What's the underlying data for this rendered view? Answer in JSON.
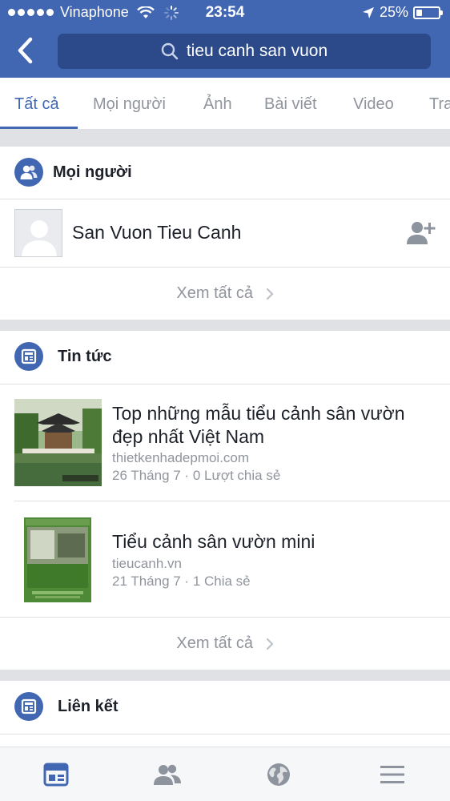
{
  "status_bar": {
    "carrier": "Vinaphone",
    "time": "23:54",
    "battery": "25%",
    "battery_level": 0.25
  },
  "header": {
    "back_icon": "chevron-left-icon",
    "search_icon": "search-icon",
    "query": "tieu canh san vuon"
  },
  "tabs": [
    {
      "label": "Tất cả",
      "active": true
    },
    {
      "label": "Mọi người",
      "active": false
    },
    {
      "label": "Ảnh",
      "active": false
    },
    {
      "label": "Bài viết",
      "active": false
    },
    {
      "label": "Video",
      "active": false
    },
    {
      "label": "Tra",
      "active": false
    }
  ],
  "people_section": {
    "title": "Mọi người",
    "icon": "people-icon",
    "results": [
      {
        "name": "San Vuon Tieu Canh",
        "action_icon": "add-friend-icon"
      }
    ],
    "see_all": "Xem tất cả"
  },
  "news_section": {
    "title": "Tin tức",
    "icon": "news-icon",
    "items": [
      {
        "title": "Top những mẫu tiểu cảnh sân vườn đẹp nhất Việt Nam",
        "domain": "thietkenhadepmoi.com",
        "meta": "26 Tháng 7 · 0 Lượt chia sẻ"
      },
      {
        "title": "Tiểu cảnh sân vườn mini",
        "domain": "tieucanh.vn",
        "meta": "21 Tháng 7 · 1 Chia sẻ"
      }
    ],
    "see_all": "Xem tất cả"
  },
  "links_section": {
    "title": "Liên kết",
    "icon": "news-icon"
  },
  "bottom_nav": [
    {
      "icon": "news-feed-icon",
      "active": true
    },
    {
      "icon": "friends-icon",
      "active": false
    },
    {
      "icon": "globe-icon",
      "active": false
    },
    {
      "icon": "menu-icon",
      "active": false
    }
  ],
  "colors": {
    "brand": "#4267b2",
    "muted_text": "#90949c"
  }
}
